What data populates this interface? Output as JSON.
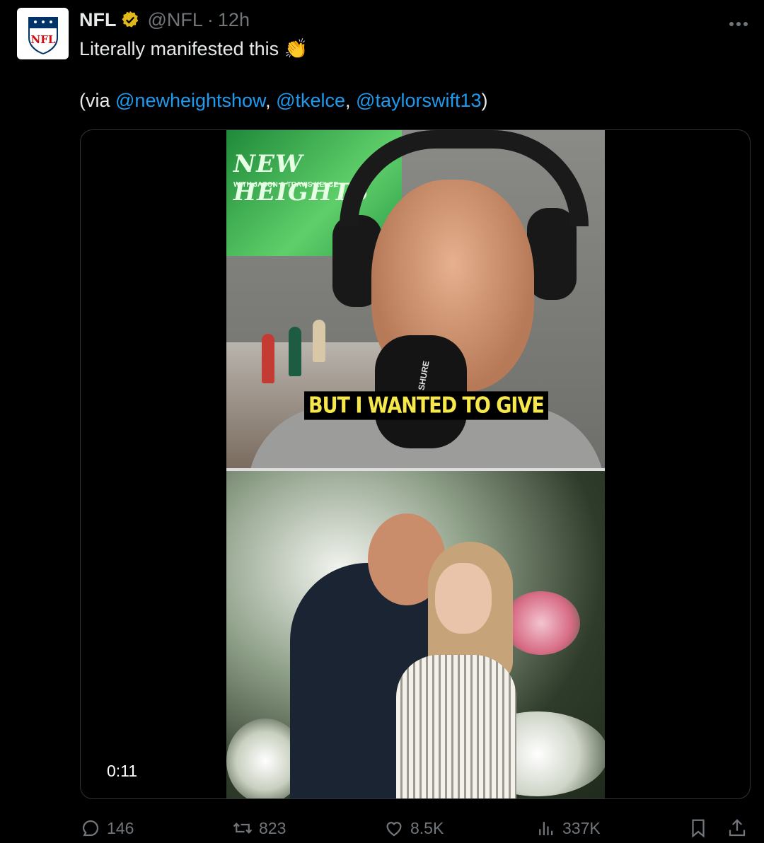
{
  "tweet": {
    "author_name": "NFL",
    "author_handle": "@NFL",
    "separator": "·",
    "time_ago": "12h",
    "avatar_logo_text": "NFL",
    "text_line1": "Literally manifested this",
    "emoji": "👏",
    "credit_prefix": "(via ",
    "mentions": [
      "@newheightshow",
      "@tkelce",
      "@taylorswift13"
    ],
    "comma": ", ",
    "credit_suffix": ")"
  },
  "media": {
    "poster_title": "NEW HEIGHTS",
    "poster_subtitle": "WITH JASON & TRAVIS KELCE",
    "mic_brand": "SHURE",
    "caption": "BUT I WANTED TO GIVE",
    "duration": "0:11"
  },
  "actions": {
    "replies": "146",
    "reposts": "823",
    "likes": "8.5K",
    "views": "337K"
  },
  "colors": {
    "background": "#000000",
    "text": "#e7e9ea",
    "muted": "#71767b",
    "link": "#1d9bf0",
    "verified_badge": "#e2b719",
    "caption_text": "#f6e84a"
  },
  "icons": [
    "more-icon",
    "verified-badge-icon",
    "reply-icon",
    "repost-icon",
    "like-icon",
    "views-icon",
    "bookmark-icon",
    "share-icon"
  ]
}
